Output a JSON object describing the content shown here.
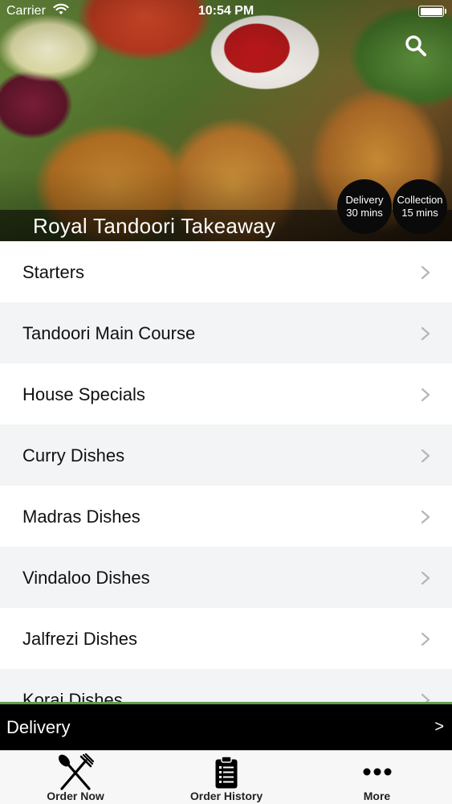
{
  "status_bar": {
    "carrier": "Carrier",
    "time": "10:54 PM"
  },
  "header": {
    "restaurant_name": "Royal Tandoori Takeaway",
    "search_icon": "search-icon",
    "delivery_badge": {
      "title": "Delivery",
      "time": "30 mins"
    },
    "collection_badge": {
      "title": "Collection",
      "time": "15 mins"
    }
  },
  "menu": {
    "items": [
      {
        "label": "Starters"
      },
      {
        "label": "Tandoori Main Course"
      },
      {
        "label": "House Specials"
      },
      {
        "label": "Curry Dishes"
      },
      {
        "label": "Madras Dishes"
      },
      {
        "label": "Vindaloo Dishes"
      },
      {
        "label": "Jalfrezi Dishes"
      },
      {
        "label": "Korai Dishes"
      }
    ]
  },
  "order_mode_bar": {
    "label": "Delivery",
    "arrow": ">"
  },
  "tab_bar": {
    "tabs": [
      {
        "label": "Order Now",
        "icon": "fork-knife-icon"
      },
      {
        "label": "Order History",
        "icon": "clipboard-list-icon"
      },
      {
        "label": "More",
        "icon": "more-dots-icon"
      }
    ]
  },
  "colors": {
    "accent_green": "#5f9e4a",
    "bar_black": "#000000",
    "row_alt": "#f2f4f5"
  }
}
